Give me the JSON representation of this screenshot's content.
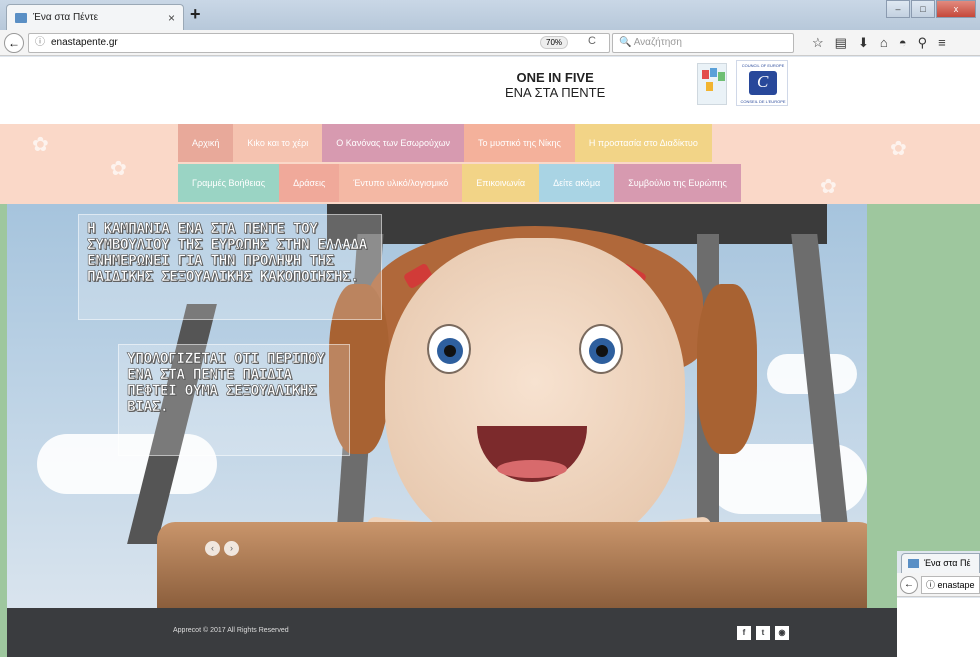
{
  "browser": {
    "tab_title": "Ένα στα Πέντε",
    "tab_close": "×",
    "new_tab": "+",
    "url": "enastapente.gr",
    "url_info": "ⓘ",
    "zoom": "70%",
    "reload": "C",
    "search_placeholder": "Αναζήτηση",
    "back": "←"
  },
  "header": {
    "logo_line1": "ONE IN FIVE",
    "logo_line2": "ΕΝΑ ΣΤΑ ΠΕΝΤΕ",
    "coe_top": "COUNCIL OF EUROPE",
    "coe_bottom": "CONSEIL DE L'EUROPE"
  },
  "menu": {
    "row1": [
      {
        "label": "Αρχική",
        "color": "#e8a99a"
      },
      {
        "label": "Κιko και το χέρι",
        "color": "#f5c3b0"
      },
      {
        "label": "Ο Κανόνας των Εσωρούχων",
        "color": "#d79ab0"
      },
      {
        "label": "Το μυστικό της Νίκης",
        "color": "#f4b19b"
      },
      {
        "label": "Η προστασία στο Διαδίκτυο",
        "color": "#f2d487"
      }
    ],
    "row2": [
      {
        "label": "Γραμμές Βοήθειας",
        "color": "#9ad4c4"
      },
      {
        "label": "Δράσεις",
        "color": "#f0a99a"
      },
      {
        "label": "Έντυπο υλικό/λογισμικό",
        "color": "#f4b8a4"
      },
      {
        "label": "Επικοινωνία",
        "color": "#f2d487"
      },
      {
        "label": "Δείτε ακόμα",
        "color": "#a9d4e4"
      },
      {
        "label": "Συμβούλιο της Ευρώπης",
        "color": "#d79ab0"
      }
    ]
  },
  "hero": {
    "caption1": "Η ΚΑΜΠΑΝΙΑ ΕΝΑ ΣΤΑ ΠΕΝΤΕ ΤΟΥ ΣΥΜΒΟΥΛΙΟΥ ΤΗΣ ΕΥΡΩΠΗΣ ΣΤΗΝ ΕΛΛΑΔΑ ΕΝΗΜΕΡΩΝΕΙ ΓΙΑ ΤΗΝ ΠΡΟΛΗΨΗ ΤΗΣ ΠΑΙΔΙΚΗΣ ΣΕΞΟΥΑΛΙΚΗΣ ΚΑΚΟΠΟΙΗΣΗΣ.",
    "caption2": "ΥΠΟΛΟΓΙΖΕΤΑΙ ΟΤΙ ΠΕΡΙΠΟΥ ΕΝΑ ΣΤΑ ΠΕΝΤΕ ΠΑΙΔΙΑ ΠΕΦΤΕΙ ΘΥΜΑ ΣΕΞΟΥΑΛΙΚΗΣ ΒΙΑΣ.",
    "prev": "‹",
    "next": "›"
  },
  "footer": {
    "copyright": "Apprecot © 2017 All Rights Reserved",
    "social": [
      "f",
      "t",
      "◉"
    ]
  },
  "second_window": {
    "tab_title": "Ένα στα Πέ",
    "url": "ⓘ enastape"
  }
}
